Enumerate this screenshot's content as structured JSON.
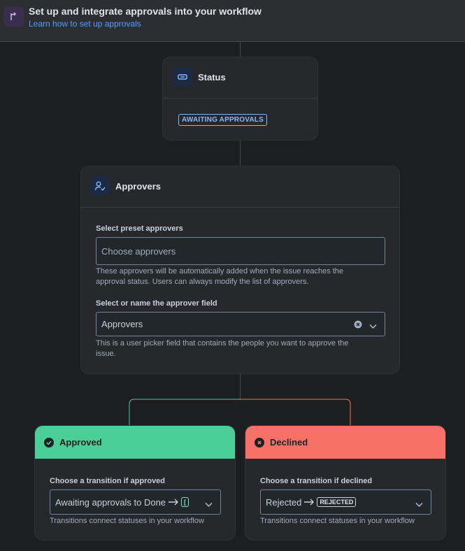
{
  "banner": {
    "title": "Set up and integrate approvals into your workflow",
    "link": "Learn how to set up approvals"
  },
  "status_card": {
    "title": "Status",
    "status": "AWAITING APPROVALS"
  },
  "approvers_card": {
    "title": "Approvers",
    "preset_label": "Select preset approvers",
    "preset_placeholder": "Choose approvers",
    "preset_helper_1": "These approvers will be automatically added when the issue reaches the",
    "preset_helper_2": "approval status. Users can always modify the list of approvers.",
    "field_label": "Select or name the approver field",
    "field_value": "Approvers",
    "field_helper_1": "This is a user picker field that contains the people you want to approve the",
    "field_helper_2": "issue."
  },
  "approved_card": {
    "title": "Approved",
    "label": "Choose a transition if approved",
    "value": "Awaiting approvals to Done",
    "badge": "[",
    "helper": "Transitions connect statuses in your workflow"
  },
  "declined_card": {
    "title": "Declined",
    "label": "Choose a transition if declined",
    "value": "Rejected",
    "badge": "REJECTED",
    "helper": "Transitions connect statuses in your workflow"
  },
  "colors": {
    "approved": "#4bce97",
    "declined": "#f87168",
    "link": "#579dff",
    "status_lozenge": "#85b8ff"
  },
  "icons": {
    "banner": "branch-icon",
    "status": "status-icon",
    "approvers": "person-check-icon",
    "approved": "check-circle-icon",
    "declined": "cross-circle-icon",
    "clear": "clear-icon",
    "chevron": "chevron-down-icon",
    "arrow": "arrow-right-icon"
  }
}
